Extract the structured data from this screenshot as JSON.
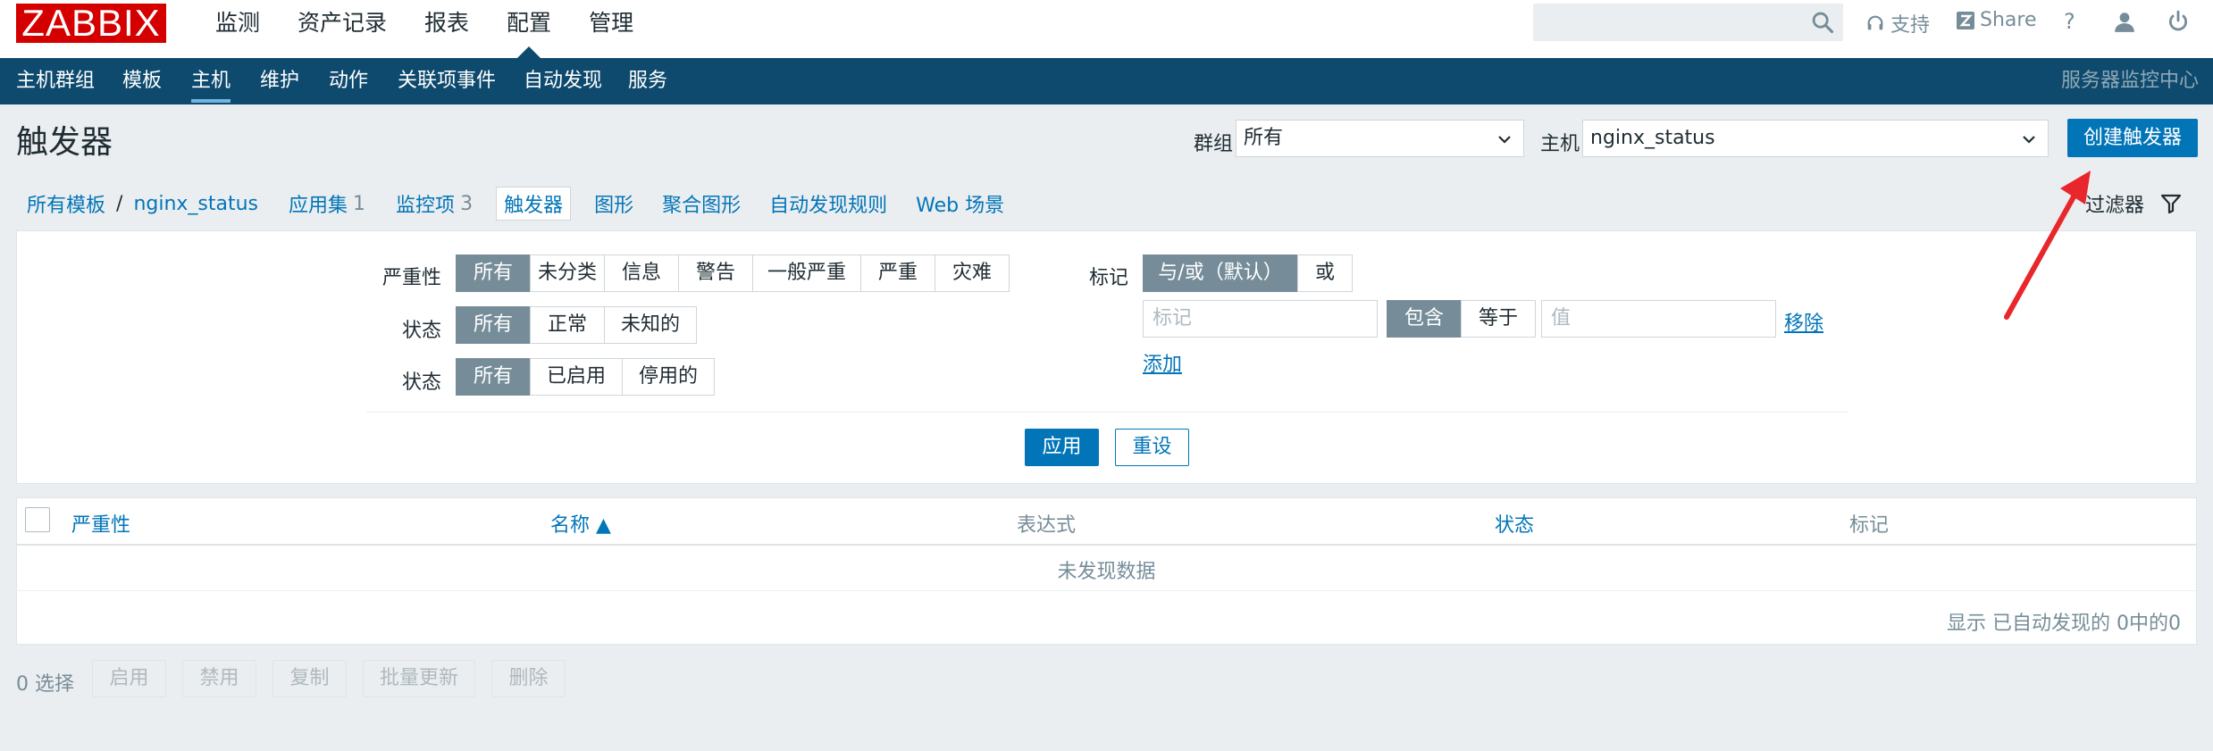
{
  "logo": "ZABBIX",
  "main_menu": [
    "监测",
    "资产记录",
    "报表",
    "配置",
    "管理"
  ],
  "header": {
    "support": "支持",
    "share": "Share",
    "help": "?"
  },
  "sub_menu": [
    "主机群组",
    "模板",
    "主机",
    "维护",
    "动作",
    "关联项事件",
    "自动发现",
    "服务"
  ],
  "system_name": "服务器监控中心",
  "page_title": "触发器",
  "group_filter": {
    "label": "群组",
    "value": "所有"
  },
  "host_filter": {
    "label": "主机",
    "value": "nginx_status"
  },
  "create_button": "创建触发器",
  "breadcrumbs": {
    "all_templates": "所有模板",
    "separator": "/",
    "host": "nginx_status",
    "applications": "应用集",
    "applications_count": "1",
    "items": "监控项",
    "items_count": "3",
    "triggers": "触发器",
    "graphs": "图形",
    "screens": "聚合图形",
    "discovery": "自动发现规则",
    "web": "Web 场景"
  },
  "filter_tab": "过滤器",
  "filter": {
    "severity_label": "严重性",
    "severity_options": [
      "所有",
      "未分类",
      "信息",
      "警告",
      "一般严重",
      "严重",
      "灾难"
    ],
    "state_label": "状态",
    "state_options": [
      "所有",
      "正常",
      "未知的"
    ],
    "status_label": "状态",
    "status_options": [
      "所有",
      "已启用",
      "停用的"
    ],
    "tags_label": "标记",
    "tags_mode": [
      "与/或（默认）",
      "或"
    ],
    "tag_placeholder": "标记",
    "tag_operator": [
      "包含",
      "等于"
    ],
    "value_placeholder": "值",
    "remove_link": "移除",
    "add_link": "添加",
    "apply_button": "应用",
    "reset_button": "重设"
  },
  "table": {
    "columns": [
      "严重性",
      "名称 ▲",
      "表达式",
      "状态",
      "标记"
    ],
    "empty_text": "未发现数据",
    "footer": "显示 已自动发现的 0中的0"
  },
  "actions": {
    "selected": "0 选择",
    "buttons": [
      "启用",
      "禁用",
      "复制",
      "批量更新",
      "删除"
    ]
  }
}
